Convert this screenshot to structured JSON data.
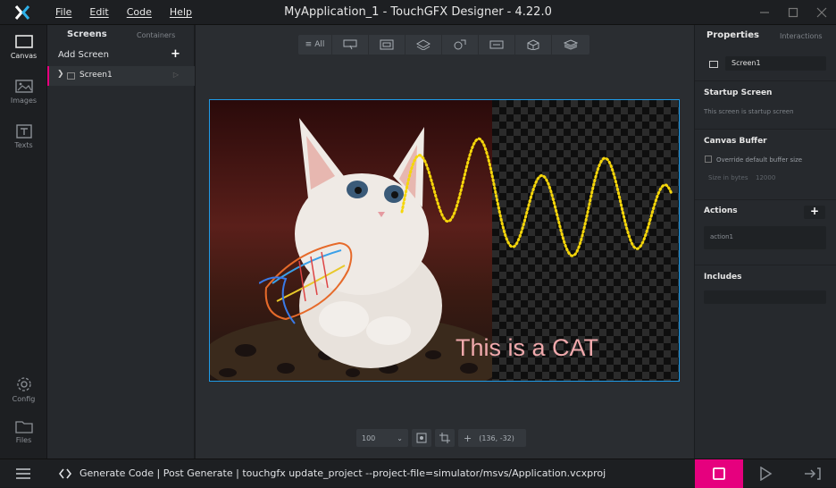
{
  "app": {
    "title": "MyApplication_1 - TouchGFX Designer - 4.22.0"
  },
  "menu": [
    "File",
    "Edit",
    "Code",
    "Help"
  ],
  "leftnav": [
    {
      "label": "Canvas",
      "icon": "canvas-icon"
    },
    {
      "label": "Images",
      "icon": "image-icon"
    },
    {
      "label": "Texts",
      "icon": "text-icon"
    },
    {
      "label": "Config",
      "icon": "gear-icon"
    },
    {
      "label": "Files",
      "icon": "folder-icon"
    }
  ],
  "screens_panel": {
    "tab_screens": "Screens",
    "tab_containers": "Containers",
    "add_screen": "Add Screen",
    "items": [
      {
        "name": "Screen1"
      }
    ]
  },
  "canvas": {
    "filter_all": "All",
    "text_widget": "This is a CAT",
    "zoom": "100",
    "coords": "(136, -32)"
  },
  "properties": {
    "tab_properties": "Properties",
    "tab_interactions": "Interactions",
    "screen_name": "Screen1",
    "startup_title": "Startup Screen",
    "startup_text": "This screen is startup screen",
    "buffer_title": "Canvas Buffer",
    "buffer_override": "Override default buffer size",
    "buffer_size_label": "Size in bytes",
    "buffer_size_value": "12000",
    "actions_title": "Actions",
    "action_item": "action1",
    "includes_title": "Includes"
  },
  "statusbar": {
    "text": "Generate Code  |  Post Generate  |  touchgfx update_project --project-file=simulator/msvs/Application.vcxproj"
  },
  "colors": {
    "accent": "#e6007e",
    "selection": "#1e9be8",
    "wave": "#f5d60a",
    "cattext": "#f0a9ac"
  }
}
